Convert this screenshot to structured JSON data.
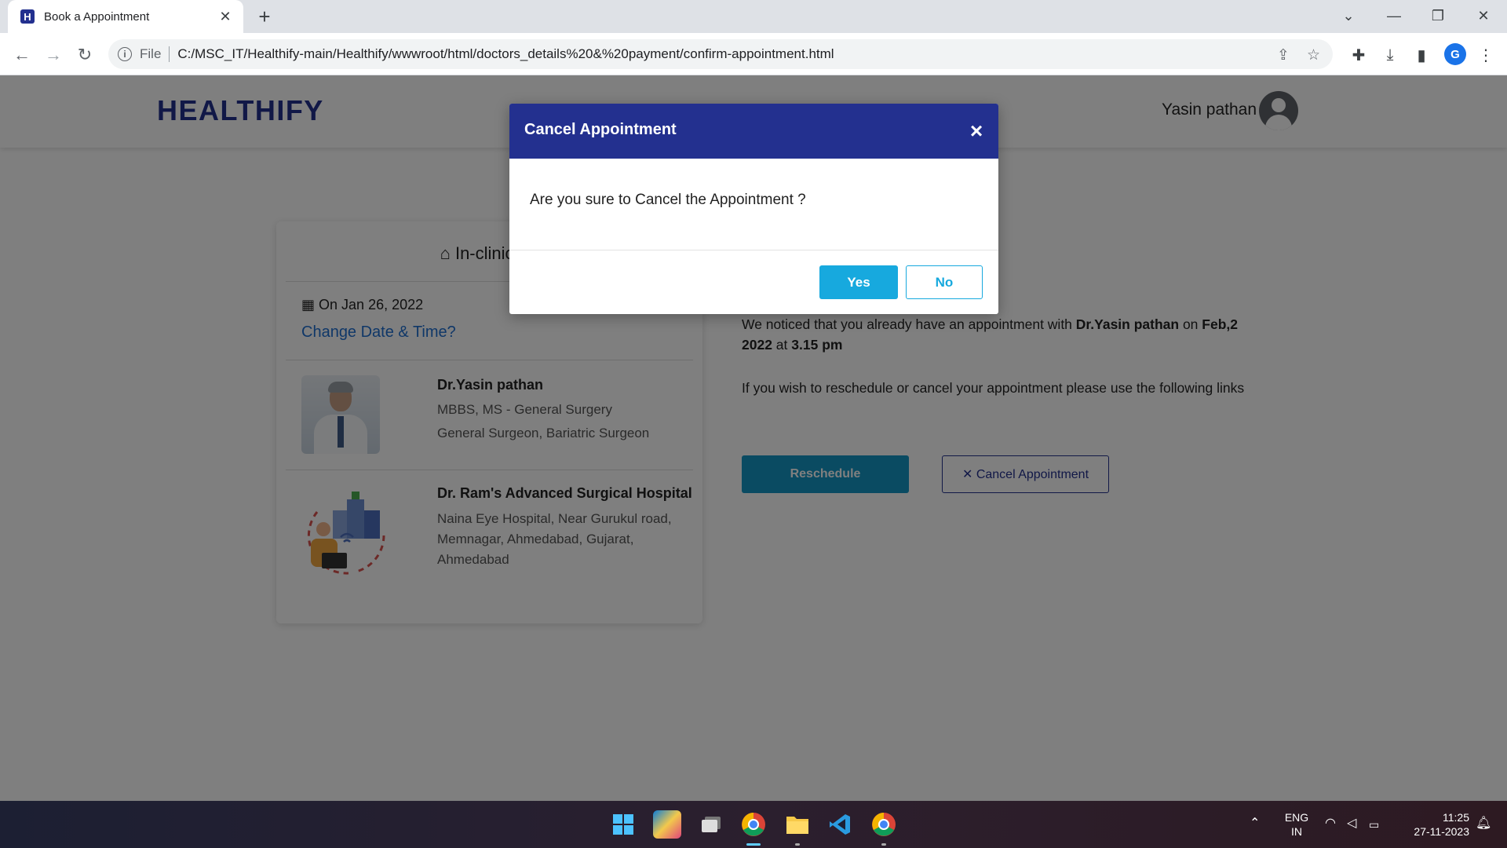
{
  "browser": {
    "tab_title": "Book a Appointment",
    "tab_favicon_letter": "H",
    "omnibox_file_label": "File",
    "url": "C:/MSC_IT/Healthify-main/Healthify/wwwroot/html/doctors_details%20&%20payment/confirm-appointment.html",
    "profile_initial": "G"
  },
  "header": {
    "brand": "HEALTHIFY",
    "user_name": "Yasin pathan"
  },
  "appointment_card": {
    "title": "In-clinic Ap",
    "date": "On Jan 26, 2022",
    "change_link": "Change Date & Time?",
    "doctor": {
      "name": "Dr.Yasin pathan",
      "degree": "MBBS, MS - General Surgery",
      "speciality": "General Surgeon, Bariatric Surgeon"
    },
    "hospital": {
      "name": "Dr. Ram's Advanced Surgical Hospital",
      "address": "Naina Eye Hospital, Near Gurukul road, Memnagar, Ahmedabad, Gujarat, Ahmedabad"
    }
  },
  "notice": {
    "prefix": "We noticed that you already have an appointment with ",
    "doctor": "Dr.Yasin pathan",
    "middle": " on ",
    "date": "Feb,2 2022",
    "at": " at ",
    "time": "3.15 pm",
    "line2": "If you wish to reschedule or cancel your appointment please use the following links"
  },
  "actions": {
    "reschedule": "Reschedule",
    "cancel": "✕ Cancel Appointment"
  },
  "modal": {
    "title": "Cancel Appointment",
    "close_glyph": "×",
    "message": "Are you sure to Cancel the Appointment ?",
    "yes": "Yes",
    "no": "No"
  },
  "taskbar": {
    "lang_top": "ENG",
    "lang_bottom": "IN",
    "time": "11:25",
    "date": "27-11-2023"
  },
  "colors": {
    "brand": "#23308f",
    "accent": "#17a9de",
    "reschedule": "#1497c4",
    "link": "#1f6fd1"
  },
  "icons": [
    "back-icon",
    "forward-icon",
    "reload-icon",
    "info-icon",
    "share-icon",
    "star-icon",
    "extensions-icon",
    "download-icon",
    "sidepanel-icon",
    "menu-icon",
    "house-icon",
    "calendar-icon",
    "close-icon",
    "user-avatar-icon"
  ]
}
